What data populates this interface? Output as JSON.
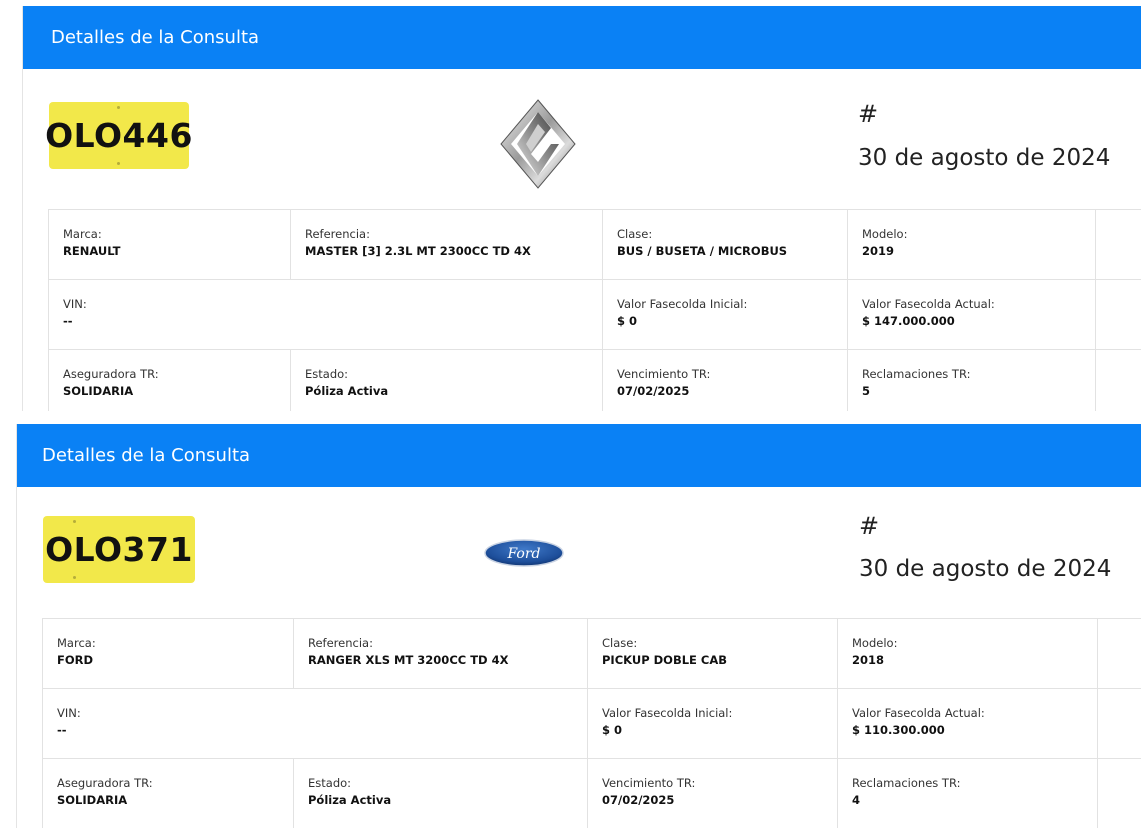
{
  "cards": [
    {
      "header": "Detalles de la Consulta",
      "plate": "OLO446",
      "brand_logo": "renault-logo-icon",
      "hash": "#",
      "date": "30 de agosto de 2024",
      "rows": [
        [
          {
            "label": "Marca:",
            "value": "RENAULT"
          },
          {
            "label": "Referencia:",
            "value": "MASTER [3] 2.3L MT 2300CC TD 4X"
          },
          {
            "label": "Clase:",
            "value": "BUS / BUSETA / MICROBUS"
          },
          {
            "label": "Modelo:",
            "value": "2019"
          }
        ],
        [
          {
            "label": "VIN:",
            "value": "--"
          },
          {
            "label": "Valor Fasecolda Inicial:",
            "value": "$ 0"
          },
          {
            "label": "Valor Fasecolda Actual:",
            "value": "$ 147.000.000"
          }
        ],
        [
          {
            "label": "Aseguradora TR:",
            "value": "SOLIDARIA"
          },
          {
            "label": "Estado:",
            "value": "Póliza Activa"
          },
          {
            "label": "Vencimiento TR:",
            "value": "07/02/2025"
          },
          {
            "label": "Reclamaciones TR:",
            "value": "5"
          }
        ]
      ]
    },
    {
      "header": "Detalles de la Consulta",
      "plate": "OLO371",
      "brand_logo": "ford-logo-icon",
      "brand_logo_text": "Ford",
      "hash": "#",
      "date": "30 de agosto de 2024",
      "rows": [
        [
          {
            "label": "Marca:",
            "value": "FORD"
          },
          {
            "label": "Referencia:",
            "value": "RANGER XLS MT 3200CC TD 4X"
          },
          {
            "label": "Clase:",
            "value": "PICKUP DOBLE CAB"
          },
          {
            "label": "Modelo:",
            "value": "2018"
          }
        ],
        [
          {
            "label": "VIN:",
            "value": "--"
          },
          {
            "label": "Valor Fasecolda Inicial:",
            "value": "$ 0"
          },
          {
            "label": "Valor Fasecolda Actual:",
            "value": "$ 110.300.000"
          }
        ],
        [
          {
            "label": "Aseguradora TR:",
            "value": "SOLIDARIA"
          },
          {
            "label": "Estado:",
            "value": "Póliza Activa"
          },
          {
            "label": "Vencimiento TR:",
            "value": "07/02/2025"
          },
          {
            "label": "Reclamaciones TR:",
            "value": "4"
          }
        ]
      ]
    }
  ],
  "colors": {
    "header_bg": "#0a81f5",
    "plate_bg": "#f2e84a"
  }
}
